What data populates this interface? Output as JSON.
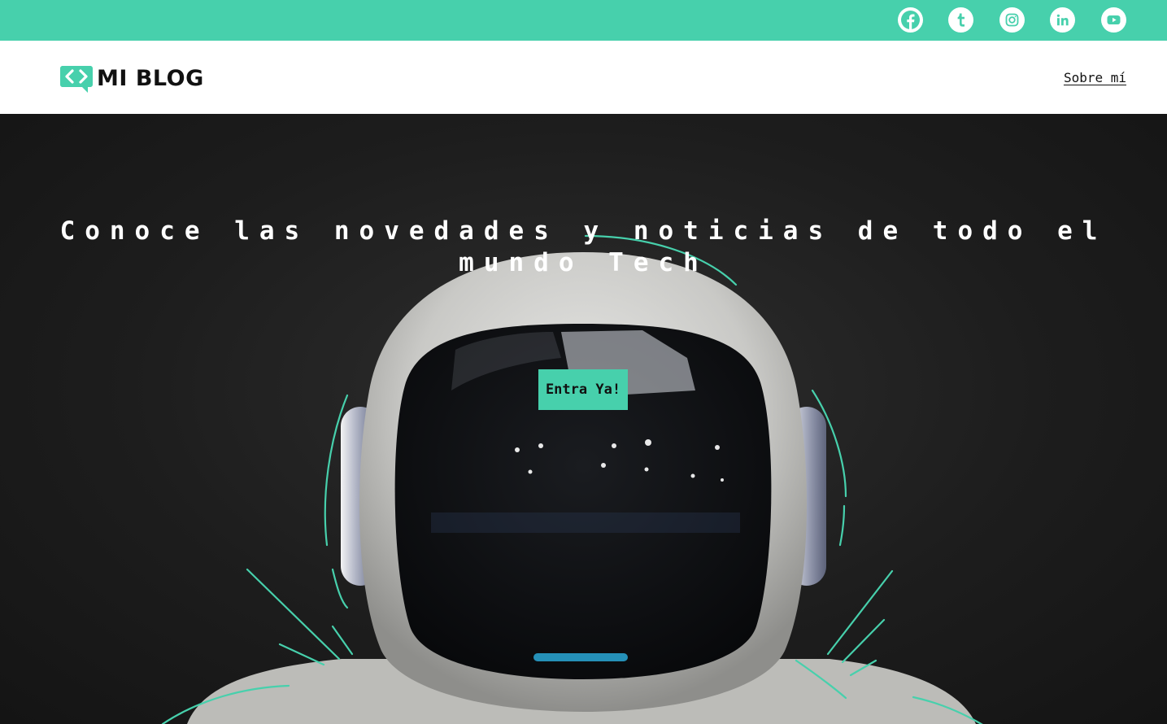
{
  "colors": {
    "accent": "#47d0ac",
    "topbar_bg": "#47d0ac",
    "hero_bg": "#1e1e1e",
    "text_dark": "#111111",
    "text_light": "#ffffff"
  },
  "topbar": {
    "social_links": [
      {
        "icon": "facebook-icon"
      },
      {
        "icon": "tumblr-icon"
      },
      {
        "icon": "instagram-icon"
      },
      {
        "icon": "linkedin-icon"
      },
      {
        "icon": "youtube-icon"
      }
    ]
  },
  "header": {
    "logo_icon": "code-chat-bubble-icon",
    "logo_text": "MI BLOG",
    "nav": {
      "about_label": "Sobre mí"
    }
  },
  "hero": {
    "title": "Conoce las novedades y noticias de todo el mundo Tech",
    "cta_label": "Entra Ya!",
    "background_image": "astronaut-robot-helmet"
  }
}
